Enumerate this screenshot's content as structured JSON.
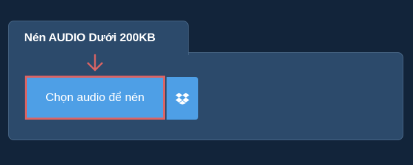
{
  "panel": {
    "title": "Nén AUDIO Dưới 200KB"
  },
  "upload": {
    "button_label": "Chọn audio để nén",
    "dropbox_icon": "dropbox-icon",
    "arrow_icon": "arrow-down-icon"
  },
  "colors": {
    "background": "#12243a",
    "panel": "#2c4a6b",
    "button": "#4e9fe6",
    "highlight": "#db6464"
  }
}
